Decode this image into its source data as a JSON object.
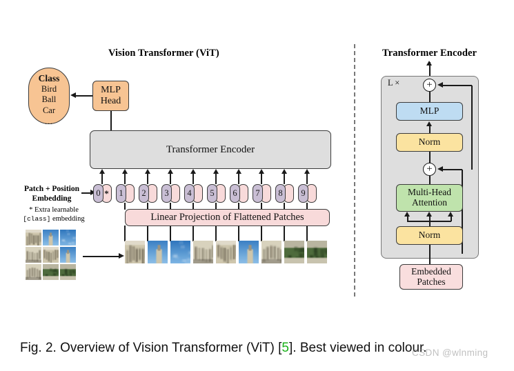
{
  "figure": {
    "caption_prefix": "Fig. 2. Overview of Vision Transformer (ViT) [",
    "caption_ref": "5",
    "caption_suffix": "]. Best viewed in colour.",
    "watermark": "CSDN @wlnming"
  },
  "left_panel": {
    "title": "Vision Transformer (ViT)",
    "class_capsule": {
      "heading": "Class",
      "items": [
        "Bird",
        "Ball",
        "Car"
      ],
      "ellipsis": "..."
    },
    "mlp_head": {
      "line1": "MLP",
      "line2": "Head"
    },
    "transformer_encoder": "Transformer Encoder",
    "linear_projection": "Linear Projection of Flattened Patches",
    "patch_pos_label_line1": "Patch + Position",
    "patch_pos_label_line2": "Embedding",
    "extra_note_line1": "* Extra learnable",
    "extra_note_mono": "[class]",
    "extra_note_line2_tail": " embedding",
    "tokens": [
      {
        "num": "0",
        "emb": "*"
      },
      {
        "num": "1",
        "emb": ""
      },
      {
        "num": "2",
        "emb": ""
      },
      {
        "num": "3",
        "emb": ""
      },
      {
        "num": "4",
        "emb": ""
      },
      {
        "num": "5",
        "emb": ""
      },
      {
        "num": "6",
        "emb": ""
      },
      {
        "num": "7",
        "emb": ""
      },
      {
        "num": "8",
        "emb": ""
      },
      {
        "num": "9",
        "emb": ""
      }
    ]
  },
  "right_panel": {
    "title": "Transformer Encoder",
    "repeat_label": "L ×",
    "blocks": {
      "mlp": "MLP",
      "norm_top": "Norm",
      "attention_line1": "Multi-Head",
      "attention_line2": "Attention",
      "norm_bottom": "Norm",
      "embedded_line1": "Embedded",
      "embedded_line2": "Patches"
    },
    "residual_symbol": "+"
  },
  "colors": {
    "class_capsule": "#f7c493",
    "mlp_head": "#f7c493",
    "encoder_grey": "#dedede",
    "linear_projection_pink": "#f8dada",
    "token_number_purple": "#c9bed4",
    "token_embedding_pink": "#f8dada",
    "mlp_blue": "#bedcf2",
    "norm_yellow": "#fbe3a0",
    "attention_green": "#bfe3ac",
    "embedded_pink": "#f8dada",
    "reference_green": "#18b018"
  }
}
